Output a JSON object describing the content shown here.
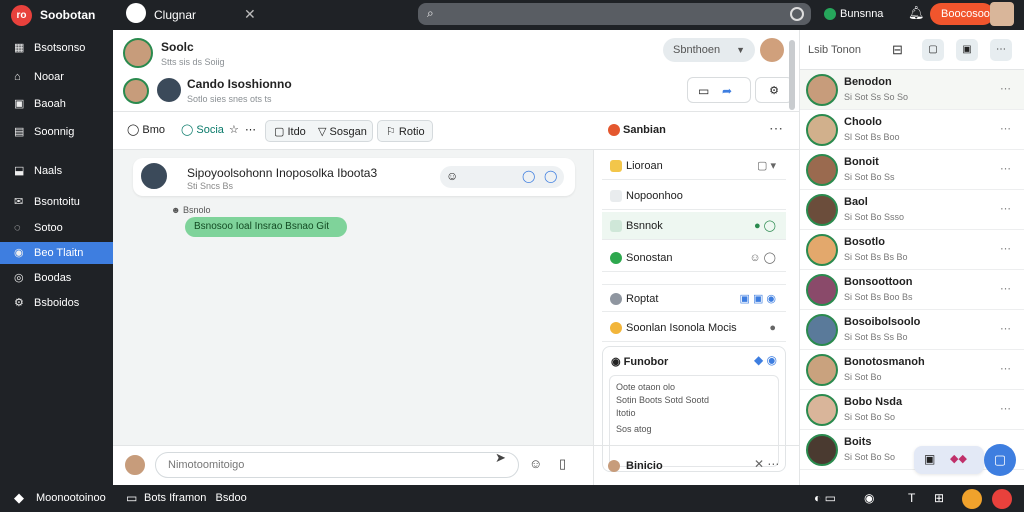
{
  "app": {
    "brand": "Soobotan",
    "logo_text": "ro",
    "tab_label": "Clugnar"
  },
  "status": {
    "label": "Bunsnna",
    "pill": "Boocosoo"
  },
  "sidebar": {
    "items": [
      {
        "label": "Bsotsonso",
        "icon": "grid-icon"
      },
      {
        "label": "Nooar",
        "icon": "home-icon"
      },
      {
        "label": "Baoah",
        "icon": "folder-icon"
      },
      {
        "label": "Soonnig",
        "icon": "calendar-icon"
      },
      {
        "label": "Naals",
        "icon": "inbox-icon"
      },
      {
        "label": "Bsontoitu",
        "icon": "mail-icon"
      },
      {
        "label": "Sotoo",
        "icon": "chat-icon"
      },
      {
        "label": "Beo Tlaitn",
        "icon": "team-icon"
      },
      {
        "label": "Boodas",
        "icon": "globe-icon"
      },
      {
        "label": "Bsboidos",
        "icon": "settings-icon"
      }
    ],
    "active": 7
  },
  "header": {
    "name": "Soolc",
    "sub": "Stts sis ds Soiig",
    "group": "Cando Isoshionno",
    "group_sub": "Sotlo sies snes ots ts",
    "select": "Sbnthoen"
  },
  "tabs": [
    {
      "label": "Bmo"
    },
    {
      "label": "Socia"
    },
    {
      "label": "Itdo"
    },
    {
      "label": "Sosgan"
    },
    {
      "label": "Rotio"
    }
  ],
  "panel": {
    "title": "Sanbian"
  },
  "messages": {
    "first_text": "Sipoyoolsohonn Inoposolka Iboota3",
    "first_sub": "Sti Sncs Bs",
    "reply_meta": "Bsnolo",
    "reply_text": "Bsnosoo Ioal Insrao Bsnao Git"
  },
  "right_panel": {
    "rows": [
      {
        "label": "Lioroan"
      },
      {
        "label": "Nopoonhoo"
      },
      {
        "label": "Bsnnok"
      },
      {
        "label": "Sonostan"
      }
    ],
    "section2": [
      {
        "label": "Roptat"
      },
      {
        "label": "Soonlan Isonola Mocis"
      }
    ],
    "card_title": "Funobor",
    "card_lines": [
      "Oote otaon olo",
      "Sotin Boots Sotd Sootd",
      "Itotio",
      "Sos atog"
    ],
    "footer": "Binicio"
  },
  "composer": {
    "placeholder": "Nimotoomitoigo"
  },
  "contacts": {
    "title": "Lsib Tonon",
    "items": [
      {
        "name": "Benodon",
        "sub": "Si Sot Ss So So"
      },
      {
        "name": "Choolo",
        "sub": "Sl Sot Bs Boo"
      },
      {
        "name": "Bonoit",
        "sub": "Si Sot Bo Ss"
      },
      {
        "name": "Baol",
        "sub": "Si Sot Bo Ssso"
      },
      {
        "name": "Bosotlo",
        "sub": "Si Sot Bs Bs Bo"
      },
      {
        "name": "Bonsoottoon",
        "sub": "Si Sot Bs Boo Bs"
      },
      {
        "name": "Bosoibolsoolo",
        "sub": "Si Sot Bs Ss Bo"
      },
      {
        "name": "Bonotosmanoh",
        "sub": "Si Sot Bo"
      },
      {
        "name": "Bobo Nsda",
        "sub": "Si Sot Bo So"
      },
      {
        "name": "Boits",
        "sub": "Si Sot Bo So"
      }
    ]
  },
  "bottom": {
    "status": "Moonootoinoo",
    "center": "Bots Iframon",
    "center2": "Bsdoo"
  },
  "colors": {
    "accent": "#3e7ee0",
    "brand": "#e8413c",
    "dark": "#1f2226",
    "online": "#2a8a4e"
  }
}
